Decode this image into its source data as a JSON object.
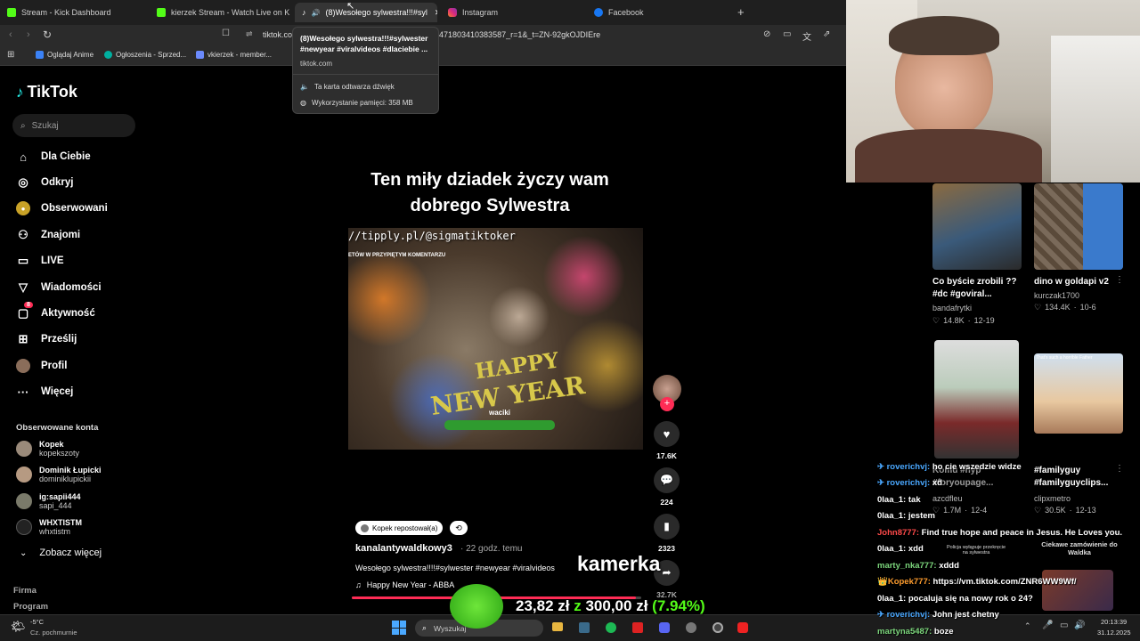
{
  "browser": {
    "tabs": [
      {
        "label": "Stream - Kick Dashboard",
        "favicon_color": "#53fc18"
      },
      {
        "label": "kierzek Stream - Watch Live on K",
        "favicon_color": "#53fc18"
      },
      {
        "label": "(8)Wesołego sylwestra!!!#syl",
        "favicon_color": "#ffffff"
      },
      {
        "label": "Instagram",
        "favicon_color": "#e1306c"
      },
      {
        "label": "Facebook",
        "favicon_color": "#1877f2"
      }
    ],
    "new_tab": "+",
    "close": "✕",
    "url_host": "tiktok.co",
    "url_rest": "471803410383587_r=1&_t=ZN-92gkOJDIEre",
    "bookmarks": [
      "Oglądaj Anime",
      "Ogłoszenia - Sprzed...",
      "vkierzek - member..."
    ],
    "tooltip": {
      "title": "(8)Wesołego sylwestra!!!#sylwester #newyear #viralvideos #dlaciebie ...",
      "domain": "tiktok.com",
      "sound": "Ta karta odtwarza dźwięk",
      "memory": "Wykorzystanie pamięci: 358 MB"
    }
  },
  "tiktok": {
    "logo": "TikTok",
    "search_placeholder": "Szukaj",
    "nav": [
      {
        "label": "Dla Ciebie",
        "icon": "home-icon"
      },
      {
        "label": "Odkryj",
        "icon": "compass-icon"
      },
      {
        "label": "Obserwowani",
        "icon": "following-icon"
      },
      {
        "label": "Znajomi",
        "icon": "friends-icon"
      },
      {
        "label": "LIVE",
        "icon": "live-icon"
      },
      {
        "label": "Wiadomości",
        "icon": "messages-icon"
      },
      {
        "label": "Aktywność",
        "icon": "activity-icon"
      },
      {
        "label": "Prześlij",
        "icon": "upload-icon"
      },
      {
        "label": "Profil",
        "icon": "profile-icon"
      },
      {
        "label": "Więcej",
        "icon": "more-icon"
      }
    ],
    "activity_badge": "8",
    "followed_header": "Obserwowane konta",
    "followed": [
      {
        "name": "Kopek",
        "handle": "kopekszoty"
      },
      {
        "name": "Dominik Łupicki",
        "handle": "dominiklupickii"
      },
      {
        "name": "ig:sapii444",
        "handle": "sapi_444"
      },
      {
        "name": "WHXTISTM",
        "handle": "whxtistm"
      }
    ],
    "see_more": "Zobacz więcej",
    "footer": [
      "Firma",
      "Program"
    ],
    "video": {
      "caption_top": "Ten miły dziadek życzy wam dobrego Sylwestra",
      "overlay_url": "//tipply.pl/@sigmatiktoker",
      "overlay_sub": "ETÓW W PRZYPIĘTYM KOMENTARZU",
      "overlay_happy": "HAPPY",
      "overlay_ny": "NEW YEAR",
      "overlay_name": "waciki",
      "reposted": "Kopek repostował(a)",
      "author": "kanalantywaldkowy3",
      "time": "· 22 godz. temu",
      "desc": "Wesołego sylwestra!!!!#sylwester #newyear #viralvideos",
      "music_note": "♫",
      "music": "Happy New Year - ABBA",
      "likes": "17.6K",
      "comments": "224",
      "saves": "2323",
      "shares": "32.7K"
    }
  },
  "recommendations": [
    {
      "title": "Co byście zrobili ??#dc #goviral...",
      "user": "bandafrytki",
      "likes": "14.8K",
      "date": "12-19"
    },
    {
      "title": "dino w goldapi v2",
      "user": "kurczak1700",
      "likes": "134.4K",
      "date": "10-6"
    },
    {
      "title": "Komu #nyp #foryoupage...",
      "user": "azcdfleu",
      "likes": "1.7M",
      "date": "12-4"
    },
    {
      "title": "#familyguy #familyguyclips...",
      "user": "clipxmetro",
      "likes": "30.5K",
      "date": "12-13"
    }
  ],
  "reco_captions": [
    "That's such a horrible Father",
    "Ciekawe zamówienie do Waldka",
    "Policja wyłąpuje przekręcie na sylwestra"
  ],
  "stream_overlay": {
    "kamerka": "kamerka",
    "donation_current": "23,82 zł",
    "donation_z": "z",
    "donation_goal": "300,00 zł",
    "donation_pct": "(7.94%)"
  },
  "chat": [
    {
      "user": "roverichvj:",
      "msg": "ho cie wszedzie widze",
      "color": "#4aa8ff",
      "badge": "✈"
    },
    {
      "user": "roverichvj:",
      "msg": "xd",
      "color": "#4aa8ff",
      "badge": "✈"
    },
    {
      "user": "0laa_1:",
      "msg": "tak",
      "color": "#ffffff",
      "badge": ""
    },
    {
      "user": "0laa_1:",
      "msg": "jestem",
      "color": "#ffffff",
      "badge": ""
    },
    {
      "user": "John8777:",
      "msg": "Find true hope and peace in Jesus. He Loves you.",
      "color": "#ff4a4a",
      "badge": ""
    },
    {
      "user": "0laa_1:",
      "msg": "xdd",
      "color": "#ffffff",
      "badge": ""
    },
    {
      "user": "marty_nka777:",
      "msg": "xddd",
      "color": "#7cd67c",
      "badge": ""
    },
    {
      "user": "Kopek777:",
      "msg": "https://vm.tiktok.com/ZNR6WW9Wf/",
      "color": "#ff9d2e",
      "badge": "👑"
    },
    {
      "user": "0laa_1:",
      "msg": "pocaluja się na nowy rok o 24?",
      "color": "#ffffff",
      "badge": ""
    },
    {
      "user": "roverichvj:",
      "msg": "John jest chetny",
      "color": "#4aa8ff",
      "badge": "✈"
    },
    {
      "user": "martyna5487:",
      "msg": "boze",
      "color": "#7cd67c",
      "badge": ""
    }
  ],
  "taskbar": {
    "weather_temp": "-5°C",
    "weather_desc": "Cz. pochmurnie",
    "search": "Wyszukaj",
    "time": "20:13:39",
    "date": "31.12.2025"
  }
}
